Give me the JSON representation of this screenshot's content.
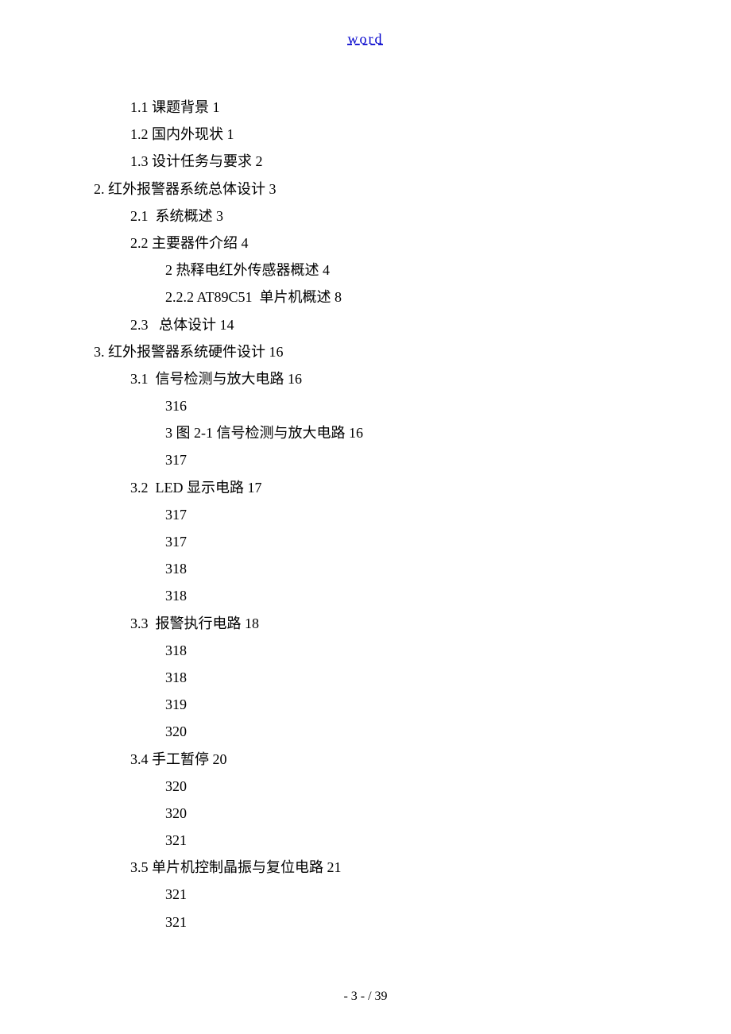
{
  "header_link": "word",
  "lines": [
    {
      "indent": 1,
      "text": "1.1 课题背景 1"
    },
    {
      "indent": 1,
      "text": "1.2 国内外现状 1"
    },
    {
      "indent": 1,
      "text": "1.3 设计任务与要求 2"
    },
    {
      "indent": 0,
      "text": "2. 红外报警器系统总体设计 3"
    },
    {
      "indent": 1,
      "text": "2.1  系统概述 3"
    },
    {
      "indent": 1,
      "text": "2.2 主要器件介绍 4"
    },
    {
      "indent": 2,
      "text": "2 热释电红外传感器概述 4"
    },
    {
      "indent": 2,
      "text": "2.2.2 AT89C51  单片机概述 8"
    },
    {
      "indent": 1,
      "text": "2.3   总体设计 14"
    },
    {
      "indent": 0,
      "text": "3. 红外报警器系统硬件设计 16"
    },
    {
      "indent": 1,
      "text": "3.1  信号检测与放大电路 16"
    },
    {
      "indent": 2,
      "text": "316"
    },
    {
      "indent": 2,
      "text": "3 图 2-1 信号检测与放大电路 16"
    },
    {
      "indent": 2,
      "text": "317"
    },
    {
      "indent": 1,
      "text": "3.2  LED 显示电路 17"
    },
    {
      "indent": 2,
      "text": "317"
    },
    {
      "indent": 2,
      "text": "317"
    },
    {
      "indent": 2,
      "text": "318"
    },
    {
      "indent": 2,
      "text": "318"
    },
    {
      "indent": 1,
      "text": "3.3  报警执行电路 18"
    },
    {
      "indent": 2,
      "text": "318"
    },
    {
      "indent": 2,
      "text": "318"
    },
    {
      "indent": 2,
      "text": "319"
    },
    {
      "indent": 2,
      "text": "320"
    },
    {
      "indent": 1,
      "text": "3.4 手工暂停 20"
    },
    {
      "indent": 2,
      "text": "320"
    },
    {
      "indent": 2,
      "text": "320"
    },
    {
      "indent": 2,
      "text": "321"
    },
    {
      "indent": 1,
      "text": "3.5 单片机控制晶振与复位电路 21"
    },
    {
      "indent": 2,
      "text": "321"
    },
    {
      "indent": 2,
      "text": "321"
    }
  ],
  "footer": "- 3 -  / 39"
}
